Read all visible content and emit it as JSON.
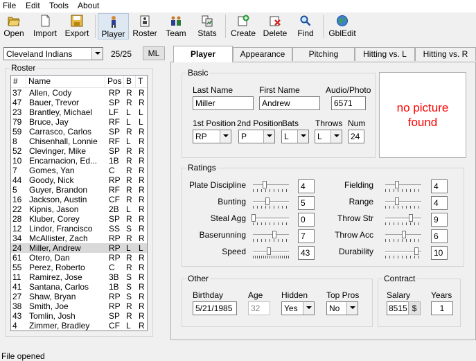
{
  "menu": [
    "File",
    "Edit",
    "Tools",
    "About"
  ],
  "toolbar": {
    "open": "Open",
    "import": "Import",
    "export": "Export",
    "player": "Player",
    "roster": "Roster",
    "team": "Team",
    "stats": "Stats",
    "create": "Create",
    "delete": "Delete",
    "find": "Find",
    "gbledit": "GblEdit"
  },
  "team": {
    "selected": "Cleveland Indians",
    "count": "25/25",
    "ml_button": "ML"
  },
  "roster": {
    "title": "Roster",
    "columns": [
      "#",
      "Name",
      "Pos",
      "B",
      "T"
    ],
    "rows": [
      [
        "37",
        "Allen, Cody",
        "RP",
        "R",
        "R"
      ],
      [
        "47",
        "Bauer, Trevor",
        "SP",
        "R",
        "R"
      ],
      [
        "23",
        "Brantley, Michael",
        "LF",
        "L",
        "L"
      ],
      [
        "79",
        "Bruce, Jay",
        "RF",
        "L",
        "L"
      ],
      [
        "59",
        "Carrasco, Carlos",
        "SP",
        "R",
        "R"
      ],
      [
        "8",
        "Chisenhall, Lonnie",
        "RF",
        "L",
        "R"
      ],
      [
        "52",
        "Clevinger, Mike",
        "SP",
        "R",
        "R"
      ],
      [
        "10",
        "Encarnacion, Ed...",
        "1B",
        "R",
        "R"
      ],
      [
        "7",
        "Gomes, Yan",
        "C",
        "R",
        "R"
      ],
      [
        "44",
        "Goody, Nick",
        "RP",
        "R",
        "R"
      ],
      [
        "5",
        "Guyer, Brandon",
        "RF",
        "R",
        "R"
      ],
      [
        "16",
        "Jackson, Austin",
        "CF",
        "R",
        "R"
      ],
      [
        "22",
        "Kipnis, Jason",
        "2B",
        "L",
        "R"
      ],
      [
        "28",
        "Kluber, Corey",
        "SP",
        "R",
        "R"
      ],
      [
        "12",
        "Lindor, Francisco",
        "SS",
        "S",
        "R"
      ],
      [
        "34",
        "McAllister, Zach",
        "RP",
        "R",
        "R"
      ],
      [
        "24",
        "Miller, Andrew",
        "RP",
        "L",
        "L"
      ],
      [
        "61",
        "Otero, Dan",
        "RP",
        "R",
        "R"
      ],
      [
        "55",
        "Perez, Roberto",
        "C",
        "R",
        "R"
      ],
      [
        "11",
        "Ramirez, Jose",
        "3B",
        "S",
        "R"
      ],
      [
        "41",
        "Santana, Carlos",
        "1B",
        "S",
        "R"
      ],
      [
        "27",
        "Shaw, Bryan",
        "RP",
        "S",
        "R"
      ],
      [
        "38",
        "Smith, Joe",
        "RP",
        "R",
        "R"
      ],
      [
        "43",
        "Tomlin, Josh",
        "SP",
        "R",
        "R"
      ],
      [
        "4",
        "Zimmer, Bradley",
        "CF",
        "L",
        "R"
      ]
    ]
  },
  "tabs": [
    "Player",
    "Appearance",
    "Pitching",
    "Hitting vs. L",
    "Hitting vs. R"
  ],
  "basic": {
    "title": "Basic",
    "last_name_label": "Last Name",
    "last_name": "Miller",
    "first_name_label": "First Name",
    "first_name": "Andrew",
    "audio_label": "Audio/Photo",
    "audio": "6571",
    "pos1_label": "1st Position",
    "pos1": "RP",
    "pos2_label": "2nd Position",
    "pos2": "P",
    "bats_label": "Bats",
    "bats": "L",
    "throws_label": "Throws",
    "throws": "L",
    "num_label": "Num",
    "num": "24"
  },
  "picture": {
    "line1": "no picture",
    "line2": "found"
  },
  "ratings": {
    "title": "Ratings",
    "left": [
      {
        "label": "Plate Discipline",
        "value": "4"
      },
      {
        "label": "Bunting",
        "value": "5"
      },
      {
        "label": "Steal Agg",
        "value": "0"
      },
      {
        "label": "Baserunning",
        "value": "7"
      },
      {
        "label": "Speed",
        "value": "43"
      }
    ],
    "right": [
      {
        "label": "Fielding",
        "value": "4"
      },
      {
        "label": "Range",
        "value": "4"
      },
      {
        "label": "Throw Str",
        "value": "9"
      },
      {
        "label": "Throw Acc",
        "value": "6"
      },
      {
        "label": "Durability",
        "value": "10"
      }
    ]
  },
  "other": {
    "title": "Other",
    "birthday_label": "Birthday",
    "birthday": "5/21/1985",
    "age_label": "Age",
    "age": "32",
    "hidden_label": "Hidden",
    "hidden": "Yes",
    "toppros_label": "Top Pros",
    "toppros": "No"
  },
  "contract": {
    "title": "Contract",
    "salary_label": "Salary",
    "salary": "8515",
    "salary_btn": "$",
    "years_label": "Years",
    "years": "1"
  },
  "status": "File opened"
}
